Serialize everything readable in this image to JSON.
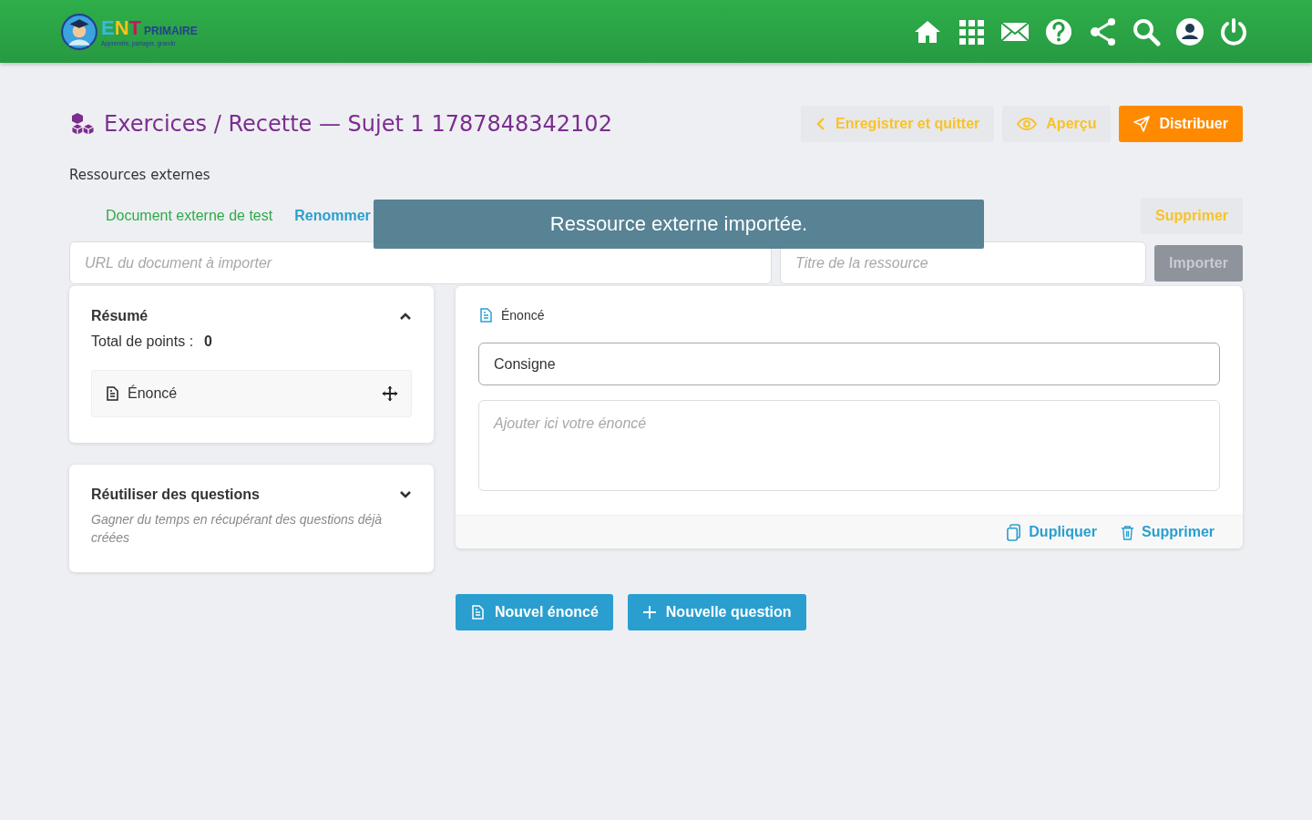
{
  "header": {
    "logo": {
      "brand": "ENT",
      "name": "PRIMAIRE",
      "tagline": "Apprendre, partager, grandir."
    }
  },
  "page": {
    "title": "Exercices / Recette — Sujet 1 1787848342102",
    "actions": [
      {
        "kind": "back",
        "label": "Enregistrer et quitter"
      },
      {
        "kind": "preview",
        "label": "Aperçu"
      },
      {
        "kind": "send",
        "label": "Distribuer"
      }
    ]
  },
  "resources": {
    "heading": "Ressources externes",
    "item": {
      "name": "Document externe de test",
      "rename": "Renommer",
      "delete": "Supprimer"
    },
    "url_field": {
      "placeholder": "URL du document à importer"
    },
    "title_field": {
      "placeholder": "Titre de la ressource"
    },
    "import_button": {
      "label": "Importer",
      "disabled": true
    }
  },
  "toast": {
    "message": "Ressource externe importée."
  },
  "summary": {
    "title": "Résumé",
    "expanded": true,
    "points_label": "Total de points :",
    "points": "0",
    "items": [
      {
        "label": "Énoncé"
      }
    ]
  },
  "reuse": {
    "title": "Réutiliser des questions",
    "expanded": false,
    "description": "Gagner du temps en récupérant des questions déjà créées"
  },
  "editor": {
    "heading": "Énoncé",
    "instruction": "Consigne",
    "statement": {
      "placeholder": "Ajouter ici votre énoncé"
    },
    "actions": [
      {
        "kind": "duplicate",
        "label": "Dupliquer"
      },
      {
        "kind": "delete",
        "label": "Supprimer"
      }
    ]
  },
  "add_buttons": [
    {
      "kind": "statement",
      "label": "Nouvel énoncé"
    },
    {
      "kind": "question",
      "label": "Nouvelle question"
    }
  ]
}
